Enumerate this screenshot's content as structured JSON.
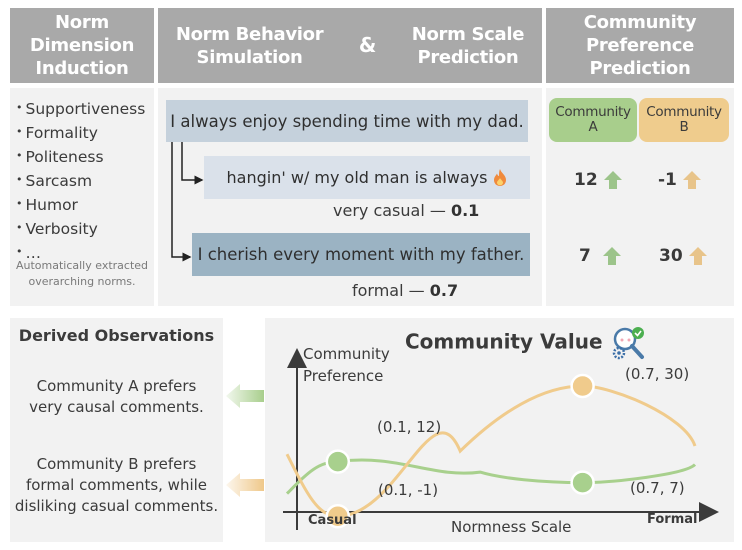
{
  "headers": {
    "col1": [
      "Norm",
      "Dimension",
      "Induction"
    ],
    "col2_left": [
      "Norm Behavior",
      "Simulation"
    ],
    "col2_amp": "&",
    "col2_right": [
      "Norm Scale",
      "Prediction"
    ],
    "col3": [
      "Community",
      "Preference",
      "Prediction"
    ]
  },
  "norm_dimensions": {
    "items": [
      "Supportiveness",
      "Formality",
      "Politeness",
      "Sarcasm",
      "Humor",
      "Verbosity",
      "…"
    ],
    "caption": [
      "Automatically extracted",
      "overarching norms."
    ]
  },
  "simulation": {
    "source_sentence": "I always enjoy spending time with my dad.",
    "variants": [
      {
        "text": "hangin' w/ my old man is always",
        "emoji": "fire-icon",
        "scale_label": "very casual —",
        "scale_value": "0.1"
      },
      {
        "text": "I cherish every moment with my father.",
        "scale_label": "formal —",
        "scale_value": "0.7"
      }
    ]
  },
  "preference": {
    "communities": [
      {
        "name": [
          "Community",
          "A"
        ],
        "color": "#a8ce8c",
        "arrow_color": "#9cc48a"
      },
      {
        "name": [
          "Community",
          "B"
        ],
        "color": "#efcc8d",
        "arrow_color": "#e8c48a"
      }
    ],
    "values": [
      {
        "A": "12",
        "B": "-1"
      },
      {
        "A": "7",
        "B": "30"
      }
    ]
  },
  "observations": {
    "title": "Derived Observations",
    "items": [
      [
        "Community A prefers",
        "very causal comments."
      ],
      [
        "Community B prefers",
        "formal comments, while",
        "disliking casual comments."
      ]
    ]
  },
  "chart_data": {
    "type": "line",
    "title": "Community Value",
    "title_icon": "magnifier-gear-check-icon",
    "xlabel": "Normness Scale",
    "ylabel": [
      "Community",
      "Preference"
    ],
    "x_tick_labels": {
      "left": "Casual",
      "right": "Formal"
    },
    "xlim": [
      0,
      1
    ],
    "ylim": [
      -5,
      40
    ],
    "grid": false,
    "series": [
      {
        "name": "Community A",
        "color": "#a8d08d",
        "points": [
          {
            "x": 0.1,
            "y": 12,
            "label": "(0.1, 12)"
          },
          {
            "x": 0.7,
            "y": 7,
            "label": "(0.7, 7)"
          }
        ]
      },
      {
        "name": "Community B",
        "color": "#f0cb8c",
        "points": [
          {
            "x": 0.1,
            "y": -1,
            "label": "(0.1, -1)"
          },
          {
            "x": 0.7,
            "y": 30,
            "label": "(0.7, 30)"
          }
        ]
      }
    ]
  }
}
